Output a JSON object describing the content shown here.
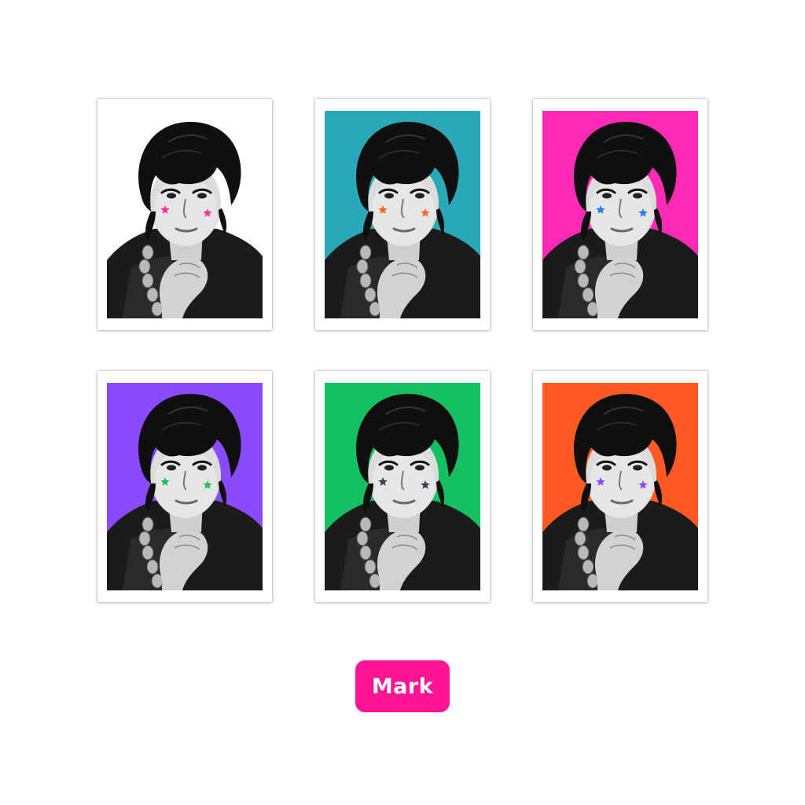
{
  "cards": [
    {
      "background": "#ffffff",
      "star_color": "#ff2fa0"
    },
    {
      "background": "#2aa8b8",
      "star_color": "#ff6a1a"
    },
    {
      "background": "#ff2ab4",
      "star_color": "#2a7de8"
    },
    {
      "background": "#8a4bff",
      "star_color": "#22c05a"
    },
    {
      "background": "#14c060",
      "star_color": "#3a3f4a"
    },
    {
      "background": "#ff5a24",
      "star_color": "#8a4bff"
    }
  ],
  "name_label": {
    "text": "Mark",
    "color": "#ff1493",
    "text_color": "#ffffff"
  },
  "icons": {
    "star": "star-icon",
    "portrait": "portrait-photo"
  }
}
